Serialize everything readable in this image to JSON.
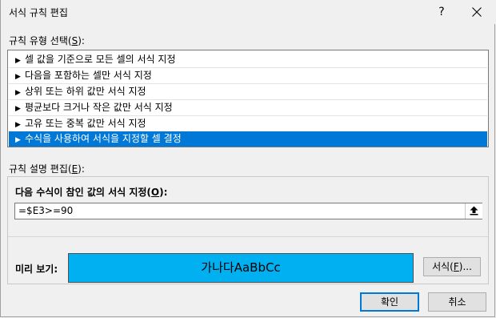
{
  "window": {
    "title": "서식 규칙 편집",
    "help": "?"
  },
  "rule_type": {
    "label": "규칙 유형 선택(",
    "accel": "S",
    "label_end": "):",
    "items": [
      {
        "label": "셀 값을 기준으로 모든 셀의 서식 지정",
        "selected": false
      },
      {
        "label": "다음을 포함하는 셀만 서식 지정",
        "selected": false
      },
      {
        "label": "상위 또는 하위 값만 서식 지정",
        "selected": false
      },
      {
        "label": "평균보다 크거나 작은 값만 서식 지정",
        "selected": false
      },
      {
        "label": "고유 또는 중복 값만 서식 지정",
        "selected": false
      },
      {
        "label": "수식을 사용하여 서식을 지정할 셀 결정",
        "selected": true
      }
    ],
    "arrow": "▶"
  },
  "rule_desc": {
    "label": "규칙 설명 편집(",
    "accel": "E",
    "label_end": "):",
    "formula_label": "다음 수식이 참인 값의 서식 지정(",
    "formula_accel": "O",
    "formula_label_end": "):",
    "formula_value": "=$E3>=90"
  },
  "preview": {
    "label": "미리 보기:",
    "sample_text": "가나다AaBbCc",
    "color": "#00b0f0"
  },
  "buttons": {
    "format": "서식(",
    "format_accel": "F",
    "format_end": ")...",
    "ok": "확인",
    "cancel": "취소"
  }
}
